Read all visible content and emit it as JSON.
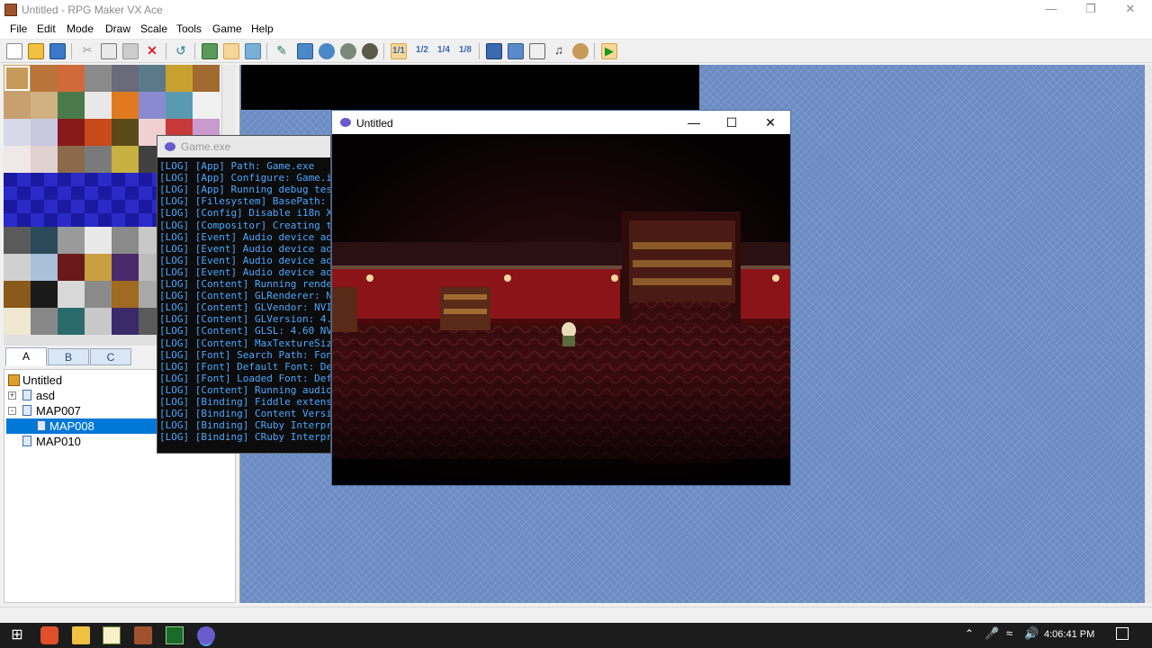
{
  "window": {
    "title": "Untitled - RPG Maker VX Ace",
    "controls": [
      "minimize-icon",
      "restore-icon",
      "close-icon"
    ]
  },
  "menu": [
    "File",
    "Edit",
    "Mode",
    "Draw",
    "Scale",
    "Tools",
    "Game",
    "Help"
  ],
  "toolbar": {
    "buttons": [
      "new-project-icon",
      "open-project-icon",
      "save-icon",
      "cut-icon",
      "copy-icon",
      "paste-icon",
      "delete-icon",
      "undo-icon",
      "map-layer-icon",
      "event-layer-icon",
      "region-icon",
      "pencil-icon",
      "rectangle-icon",
      "ellipse-icon",
      "flood-fill-icon",
      "shadow-pen-icon",
      "zoom-1-1-icon",
      "zoom-1-2-icon",
      "zoom-1-4-icon",
      "zoom-1-8-icon",
      "database-icon",
      "resource-manager-icon",
      "script-editor-icon",
      "sound-test-icon",
      "character-generator-icon",
      "playtest-icon"
    ]
  },
  "tileset_tabs": [
    "A",
    "B",
    "C"
  ],
  "map_tree": {
    "project": "Untitled",
    "maps": [
      {
        "name": "asd",
        "expander": "+",
        "level": 1
      },
      {
        "name": "MAP007",
        "expander": "-",
        "level": 1
      },
      {
        "name": "MAP008",
        "level": 2,
        "selected": true
      },
      {
        "name": "MAP010",
        "level": 1
      }
    ]
  },
  "console": {
    "title": "Game.exe",
    "lines": [
      "[LOG] [App] Path: Game.exe",
      "[LOG] [App] Configure: Game.i",
      "[LOG] [App] Running debug test",
      "[LOG] [Filesystem] BasePath: C",
      "[LOG] [Config] Disable i18n XP",
      "[LOG] [Compositor] Creating th",
      "[LOG] [Event] Audio device add",
      "[LOG] [Event] Audio device add",
      "[LOG] [Event] Audio device add",
      "[LOG] [Event] Audio device add",
      "[LOG] [Content] Running render",
      "[LOG] [Content] GLRenderer: NV",
      "[LOG] [Content] GLVendor: NVID",
      "[LOG] [Content] GLVersion: 4.6",
      "[LOG] [Content] GLSL: 4.60 NVI",
      "[LOG] [Content] MaxTextureSize",
      "[LOG] [Font] Search Path: Font",
      "[LOG] [Font] Default Font: Def",
      "[LOG] [Font] Loaded Font: Defa",
      "[LOG] [Content] Running audio",
      "[LOG] [Binding] Fiddle extens",
      "[LOG] [Binding] Content Versio",
      "[LOG] [Binding] CRuby Interpre",
      "[LOG] [Binding] CRuby Interpre"
    ]
  },
  "game_window": {
    "title": "Untitled",
    "controls": [
      "minimize-icon",
      "maximize-icon",
      "close-icon"
    ]
  },
  "taskbar": {
    "apps": [
      "start-icon",
      "brave-icon",
      "file-explorer-icon",
      "notepad-icon",
      "rpg-maker-icon",
      "terminal-icon",
      "game-icon"
    ],
    "tray": [
      "chevron-up-icon",
      "microphone-icon",
      "wifi-icon",
      "speaker-icon"
    ],
    "clock": "4:06:41 PM"
  },
  "colors": {
    "selection": "#0078d7",
    "map_bg": "#6b8cc2",
    "console_text": "#4aa8ff"
  }
}
